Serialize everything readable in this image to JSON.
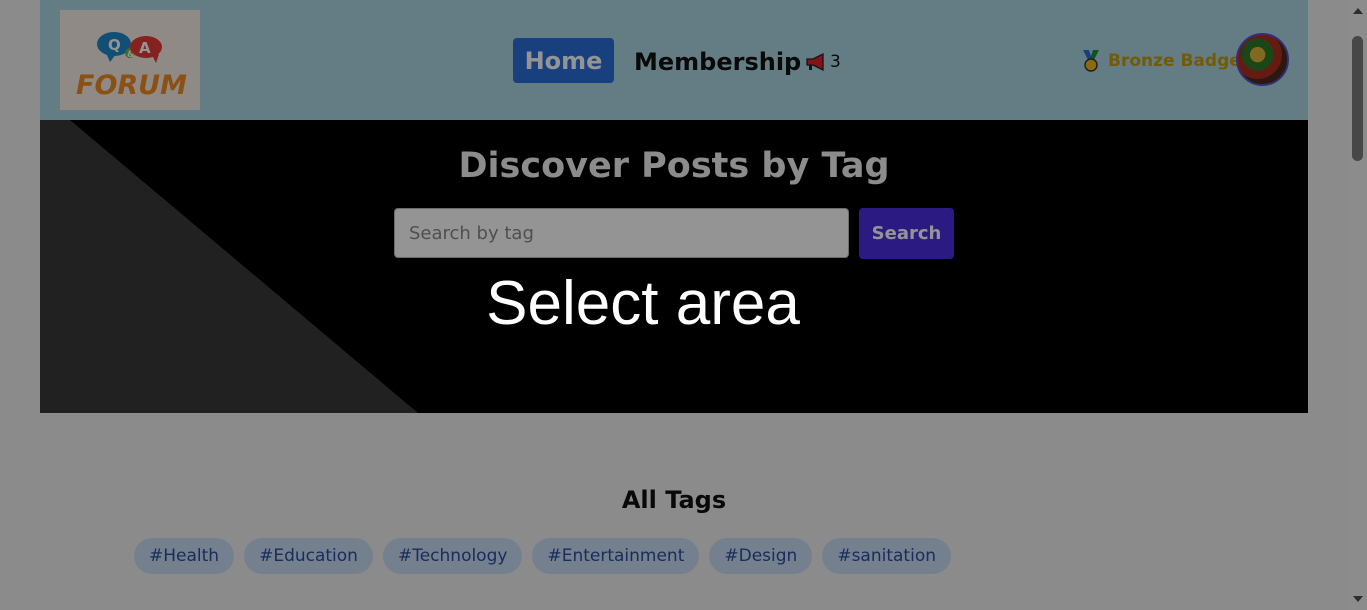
{
  "header": {
    "logo_text": "Q&A FORUM",
    "nav": {
      "home": "Home",
      "membership": "Membership"
    },
    "notifications": {
      "count": "3"
    },
    "badge": {
      "label": "Bronze Badge"
    }
  },
  "hero": {
    "title": "Discover Posts by Tag",
    "search_placeholder": "Search by tag",
    "search_button": "Search",
    "overlay_text": "Select area"
  },
  "tags_section": {
    "title": "All Tags",
    "tags": [
      "#Health",
      "#Education",
      "#Technology",
      "#Entertainment",
      "#Design",
      "#sanitation"
    ]
  },
  "colors": {
    "header_bg": "#add8e6",
    "home_button": "#2a6edb",
    "search_button": "#4b2ee0",
    "badge_text": "#c69b0c",
    "tag_bg": "#c8dcf5",
    "tag_text": "#2b4f9e"
  }
}
